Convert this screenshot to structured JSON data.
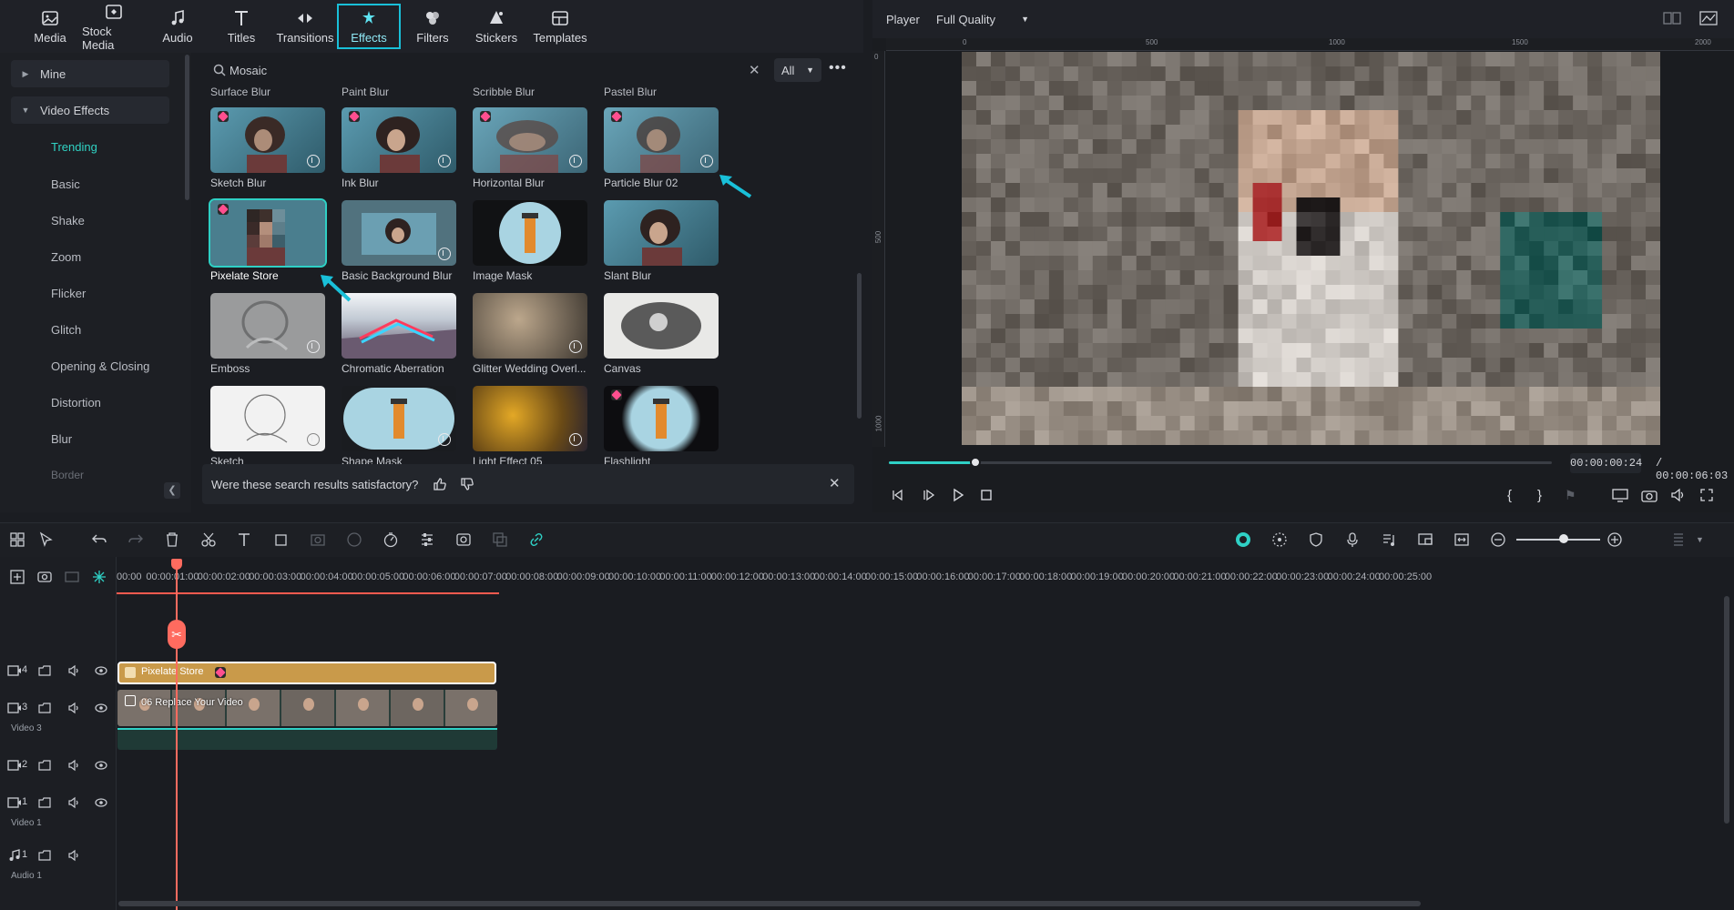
{
  "toolbar": {
    "tabs": [
      {
        "label": "Media",
        "icon": "media-icon"
      },
      {
        "label": "Stock Media",
        "icon": "stock-media-icon"
      },
      {
        "label": "Audio",
        "icon": "music-note-icon"
      },
      {
        "label": "Titles",
        "icon": "titles-icon"
      },
      {
        "label": "Transitions",
        "icon": "transitions-icon"
      },
      {
        "label": "Effects",
        "icon": "effects-icon",
        "active": true
      },
      {
        "label": "Filters",
        "icon": "filters-icon"
      },
      {
        "label": "Stickers",
        "icon": "stickers-icon"
      },
      {
        "label": "Templates",
        "icon": "templates-icon"
      }
    ]
  },
  "categories": {
    "mine": "Mine",
    "video_effects": "Video Effects",
    "subitems": [
      "Trending",
      "Basic",
      "Shake",
      "Zoom",
      "Flicker",
      "Glitch",
      "Opening & Closing",
      "Distortion",
      "Blur",
      "Border"
    ]
  },
  "search": {
    "value": "Mosaic",
    "filter": "All"
  },
  "grid": {
    "top_row_labels": [
      "Surface Blur",
      "Paint Blur",
      "Scribble Blur",
      "Pastel Blur"
    ],
    "cards": [
      {
        "label": "Sketch Blur",
        "premium": true,
        "download": true
      },
      {
        "label": "Ink Blur",
        "premium": true,
        "download": true
      },
      {
        "label": "Horizontal Blur",
        "premium": true,
        "download": true
      },
      {
        "label": "Particle Blur 02",
        "premium": true,
        "download": true
      },
      {
        "label": "Pixelate Store",
        "premium": true,
        "download": false,
        "selected": true
      },
      {
        "label": "Basic Background Blur",
        "premium": false,
        "download": true
      },
      {
        "label": "Image Mask",
        "premium": false,
        "download": false
      },
      {
        "label": "Slant Blur",
        "premium": false,
        "download": false
      },
      {
        "label": "Emboss",
        "premium": false,
        "download": true
      },
      {
        "label": "Chromatic Aberration",
        "premium": false,
        "download": false
      },
      {
        "label": "Glitter Wedding Overl...",
        "premium": false,
        "download": true
      },
      {
        "label": "Canvas",
        "premium": false,
        "download": false
      },
      {
        "label": "Sketch",
        "premium": false,
        "download": true
      },
      {
        "label": "Shape Mask",
        "premium": false,
        "download": true
      },
      {
        "label": "Light Effect 05",
        "premium": false,
        "download": true
      },
      {
        "label": "Flashlight",
        "premium": true,
        "download": false
      }
    ]
  },
  "feedback": {
    "question": "Were these search results satisfactory?"
  },
  "player": {
    "title": "Player",
    "quality": "Full Quality",
    "ruler_marks": [
      "0",
      "500",
      "1000",
      "1500",
      "2000"
    ],
    "ruler_v_marks": [
      "0",
      "500",
      "1000"
    ],
    "current_time": "00:00:00:24",
    "total_time": "/ 00:00:06:03",
    "progress": 0.13
  },
  "timeline": {
    "ticks": [
      "00:00",
      "00:00:01:00",
      "00:00:02:00",
      "00:00:03:00",
      "00:00:04:00",
      "00:00:05:00",
      "00:00:06:00",
      "00:00:07:00",
      "00:00:08:00",
      "00:00:09:00",
      "00:00:10:00",
      "00:00:11:00",
      "00:00:12:00",
      "00:00:13:00",
      "00:00:14:00",
      "00:00:15:00",
      "00:00:16:00",
      "00:00:17:00",
      "00:00:18:00",
      "00:00:19:00",
      "00:00:20:00",
      "00:00:21:00",
      "00:00:22:00",
      "00:00:23:00",
      "00:00:24:00",
      "00:00:25:00"
    ],
    "tracks": [
      {
        "num": "4",
        "name": ""
      },
      {
        "num": "3",
        "name": "Video 3"
      },
      {
        "num": "2",
        "name": ""
      },
      {
        "num": "1",
        "name": "Video 1"
      },
      {
        "num": "1",
        "name": "Audio 1"
      }
    ],
    "effect_clip": "Pixelate Store",
    "video_clip": "06 Replace Your Video"
  },
  "colors": {
    "accent": "#2fd0c5",
    "playhead": "#ff6b5f",
    "effect_clip": "#c99a4a"
  }
}
